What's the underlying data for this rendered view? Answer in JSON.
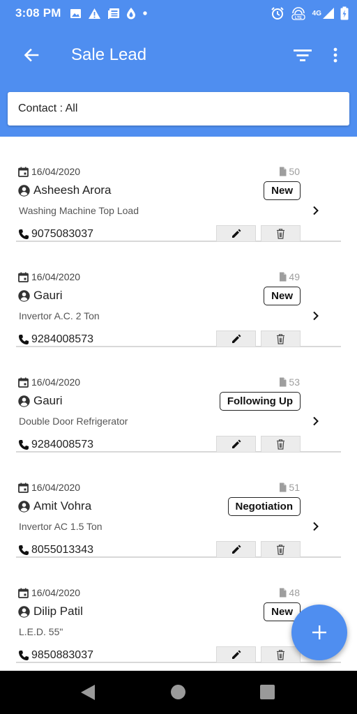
{
  "status_bar": {
    "time": "3:08 PM",
    "left_icons": [
      "image-icon",
      "warning-icon",
      "news-icon",
      "drop-icon",
      "dot-icon"
    ],
    "right_icons": [
      "alarm-icon",
      "volte-icon",
      "signal-4g-icon",
      "battery-icon"
    ],
    "network": "4G"
  },
  "app_bar": {
    "title": "Sale Lead",
    "back_icon": "arrow-back-icon",
    "filter_icon": "filter-icon",
    "more_icon": "more-vert-icon"
  },
  "contact_filter": {
    "label": "Contact : All"
  },
  "leads": [
    {
      "date": "16/04/2020",
      "id": "50",
      "name": "Asheesh Arora",
      "status": "New",
      "product": "Washing Machine Top Load",
      "phone": "9075083037"
    },
    {
      "date": "16/04/2020",
      "id": "49",
      "name": "Gauri",
      "status": "New",
      "product": "Invertor A.C. 2 Ton",
      "phone": "9284008573"
    },
    {
      "date": "16/04/2020",
      "id": "53",
      "name": "Gauri",
      "status": "Following Up",
      "product": "Double Door Refrigerator",
      "phone": "9284008573"
    },
    {
      "date": "16/04/2020",
      "id": "51",
      "name": "Amit Vohra",
      "status": "Negotiation",
      "product": "Invertor AC 1.5 Ton",
      "phone": "8055013343"
    },
    {
      "date": "16/04/2020",
      "id": "48",
      "name": "Dilip Patil",
      "status": "New",
      "product": "L.E.D. 55\"",
      "phone": "9850883037"
    }
  ],
  "fab": {
    "icon": "add-icon"
  },
  "colors": {
    "primary": "#4f8ef0",
    "divider": "#d8d8d8",
    "action_button_bg": "#ececec"
  }
}
